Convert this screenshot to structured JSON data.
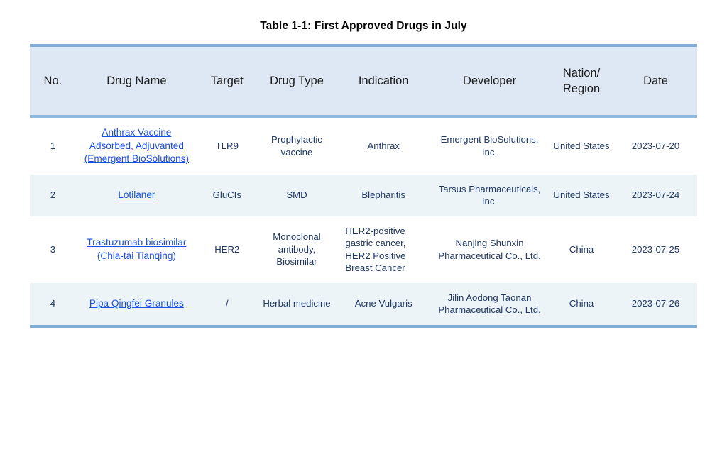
{
  "document": {
    "title": "Table 1-1:  First Approved Drugs in July"
  },
  "table": {
    "columns": [
      {
        "key": "no",
        "label": "No."
      },
      {
        "key": "drug_name",
        "label": "Drug Name"
      },
      {
        "key": "target",
        "label": "Target"
      },
      {
        "key": "drug_type",
        "label": "Drug Type"
      },
      {
        "key": "indication",
        "label": "Indication"
      },
      {
        "key": "developer",
        "label": "Developer"
      },
      {
        "key": "nation_region",
        "label": "Nation/\nRegion"
      },
      {
        "key": "nation_region_line1",
        "label": "Nation/"
      },
      {
        "key": "nation_region_line2",
        "label": "Region"
      },
      {
        "key": "date",
        "label": "Date"
      }
    ],
    "rows": [
      {
        "no": "1",
        "drug_name": "Anthrax Vaccine Adsorbed, Adjuvanted (Emergent BioSolutions)",
        "drug_name_is_link": "true",
        "target": "TLR9",
        "drug_type": "Prophylactic vaccine",
        "indication": "Anthrax",
        "developer": "Emergent BioSolutions, Inc.",
        "nation_region": "United States",
        "date": "2023-07-20"
      },
      {
        "no": "2",
        "drug_name": "Lotilaner",
        "drug_name_is_link": "true",
        "target": "GluCIs",
        "drug_type": "SMD",
        "indication": "Blepharitis",
        "developer": "Tarsus Pharmaceuticals, Inc.",
        "nation_region": "United States",
        "date": "2023-07-24"
      },
      {
        "no": "3",
        "drug_name": "Trastuzumab biosimilar (Chia-tai Tianqing)",
        "drug_name_is_link": "true",
        "target": "HER2",
        "drug_type": "Monoclonal antibody, Biosimilar",
        "indication": "HER2-positive gastric cancer, HER2 Positive Breast Cancer",
        "developer": "Nanjing Shunxin Pharmaceutical Co., Ltd.",
        "nation_region": "China",
        "date": "2023-07-25"
      },
      {
        "no": "4",
        "drug_name": "Pipa Qingfei Granules",
        "drug_name_is_link": "true",
        "target": "/",
        "drug_type": "Herbal medicine",
        "indication": "Acne Vulgaris",
        "developer": "Jilin Aodong Taonan Pharmaceutical Co., Ltd.",
        "nation_region": "China",
        "date": "2023-07-26"
      }
    ]
  },
  "colors": {
    "header_background": "#dde8f4",
    "header_rule": "#8fb9dd",
    "table_border": "#7fadd8",
    "row_stripe": "#edf4f8",
    "body_text": "#1f3864",
    "link": "#1a4fe0",
    "title_text": "#000000"
  }
}
